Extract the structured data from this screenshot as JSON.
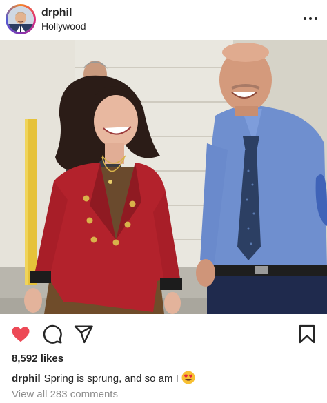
{
  "post": {
    "username": "drphil",
    "location": "Hollywood",
    "likes_text": "8,592 likes",
    "caption_user": "drphil",
    "caption_text": "Spring is sprung, and so am I",
    "caption_emoji": "smiling-face-with-heart-eyes",
    "comments_link": "View all 283 comments",
    "liked": true
  },
  "icons": {
    "more": "more-horizontal-icon",
    "like": "heart-icon",
    "comment": "comment-bubble-icon",
    "share": "paper-plane-icon",
    "save": "bookmark-icon"
  },
  "colors": {
    "like_red": "#ed4956",
    "text": "#262626",
    "secondary_text": "#8e8e8e",
    "blazer_red": "#b3222c"
  }
}
